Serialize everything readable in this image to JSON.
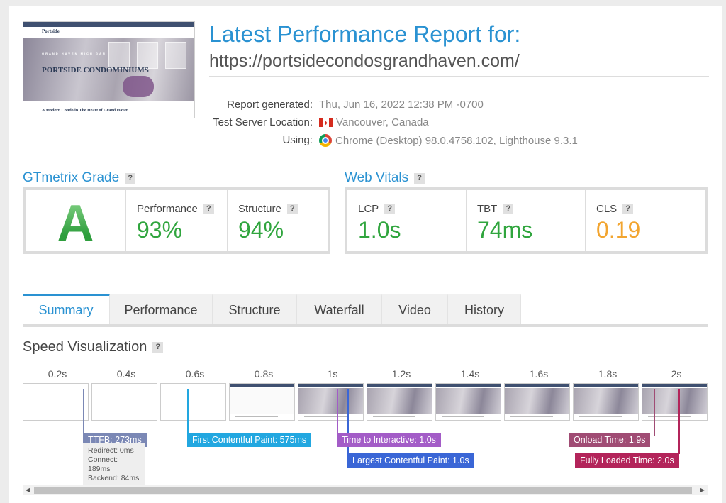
{
  "thumb": {
    "logo": "Portside",
    "subtitle": "GRAND HAVEN MICHIGAN",
    "title": "PORTSIDE CONDOMINIUMS",
    "body": "A Modern Condo in The Heart of Grand Haven"
  },
  "header": {
    "title": "Latest Performance Report for:",
    "url": "https://portsidecondosgrandhaven.com/"
  },
  "meta": {
    "generated_label": "Report generated:",
    "generated_value": "Thu, Jun 16, 2022 12:38 PM -0700",
    "location_label": "Test Server Location:",
    "location_value": "Vancouver, Canada",
    "using_label": "Using:",
    "using_value": "Chrome (Desktop) 98.0.4758.102, Lighthouse 9.3.1"
  },
  "grade": {
    "title": "GTmetrix Grade",
    "help": "?",
    "letter": "A",
    "performance_label": "Performance",
    "performance_value": "93%",
    "structure_label": "Structure",
    "structure_value": "94%"
  },
  "vitals": {
    "title": "Web Vitals",
    "help": "?",
    "lcp_label": "LCP",
    "lcp_value": "1.0s",
    "tbt_label": "TBT",
    "tbt_value": "74ms",
    "cls_label": "CLS",
    "cls_value": "0.19"
  },
  "tabs": [
    "Summary",
    "Performance",
    "Structure",
    "Waterfall",
    "Video",
    "History"
  ],
  "speed": {
    "title": "Speed Visualization",
    "help": "?",
    "ticks": [
      "0.2s",
      "0.4s",
      "0.6s",
      "0.8s",
      "1s",
      "1.2s",
      "1.4s",
      "1.6s",
      "1.8s",
      "2s"
    ],
    "markers": {
      "ttfb": "TTFB: 273ms",
      "fcp": "First Contentful Paint: 575ms",
      "tti": "Time to Interactive: 1.0s",
      "lcp": "Largest Contentful Paint: 1.0s",
      "onload": "Onload Time: 1.9s",
      "fully": "Fully Loaded Time: 2.0s"
    },
    "ttfb_detail": {
      "redirect": "Redirect: 0ms",
      "connect": "Connect: 189ms",
      "backend": "Backend: 84ms"
    }
  },
  "colors": {
    "accent": "#2a92d2",
    "ttfb": "#7b88b5",
    "fcp": "#22a7e0",
    "tti": "#a35cc7",
    "lcp": "#3a66d6",
    "onload": "#a04c74",
    "fully": "#b3245a"
  }
}
